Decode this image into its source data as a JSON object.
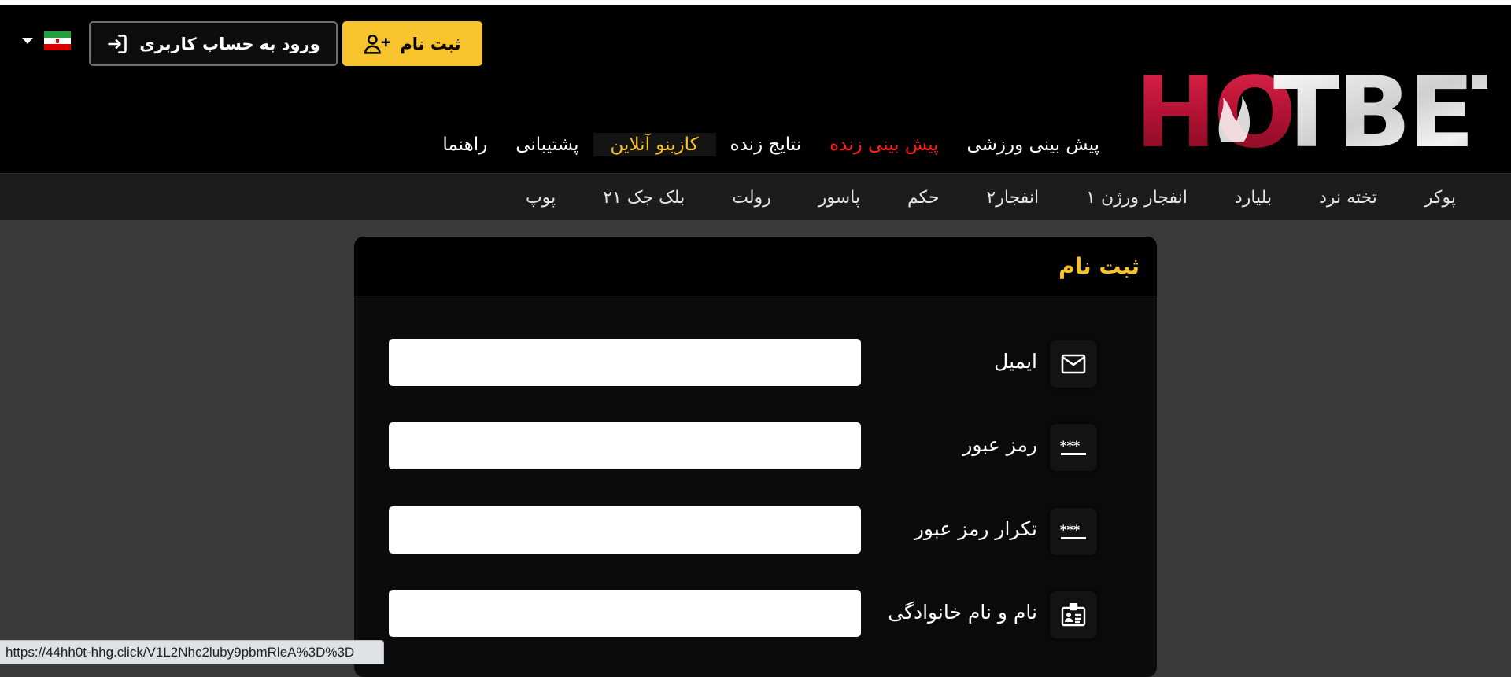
{
  "header": {
    "login_button": "ورود به حساب کاربری",
    "register_button": "ثبت نام",
    "logo_text": "HOTBET",
    "language_flag": "iran-flag-icon"
  },
  "main_nav": [
    {
      "label": "پیش بینی ورزشی",
      "style": "normal"
    },
    {
      "label": "پیش بینی زنده",
      "style": "red"
    },
    {
      "label": "نتایج زنده",
      "style": "normal"
    },
    {
      "label": "کازینو آنلاین",
      "style": "gold"
    },
    {
      "label": "پشتیبانی",
      "style": "normal"
    },
    {
      "label": "راهنما",
      "style": "normal"
    }
  ],
  "sub_nav": [
    "پوکر",
    "تخته نرد",
    "بلیارد",
    "انفجار ورژن ۱",
    "انفجار۲",
    "حکم",
    "پاسور",
    "رولت",
    "بلک جک ۲۱",
    "پوپ"
  ],
  "form": {
    "title": "ثبت نام",
    "fields": [
      {
        "label": "ایمیل",
        "icon": "envelope-icon",
        "value": ""
      },
      {
        "label": "رمز عبور",
        "icon": "password-icon",
        "value": ""
      },
      {
        "label": "تکرار رمز عبور",
        "icon": "password-icon",
        "value": ""
      },
      {
        "label": "نام و نام خانوادگی",
        "icon": "id-card-icon",
        "value": ""
      }
    ]
  },
  "status_bar": {
    "url": "https://44hh0t-hhg.click/V1L2Nhc2luby9pbmRleA%3D%3D"
  },
  "colors": {
    "accent": "#f8c42e",
    "live": "#ff1f1f",
    "header_bg": "#000000",
    "page_bg": "#3a3a3a"
  }
}
